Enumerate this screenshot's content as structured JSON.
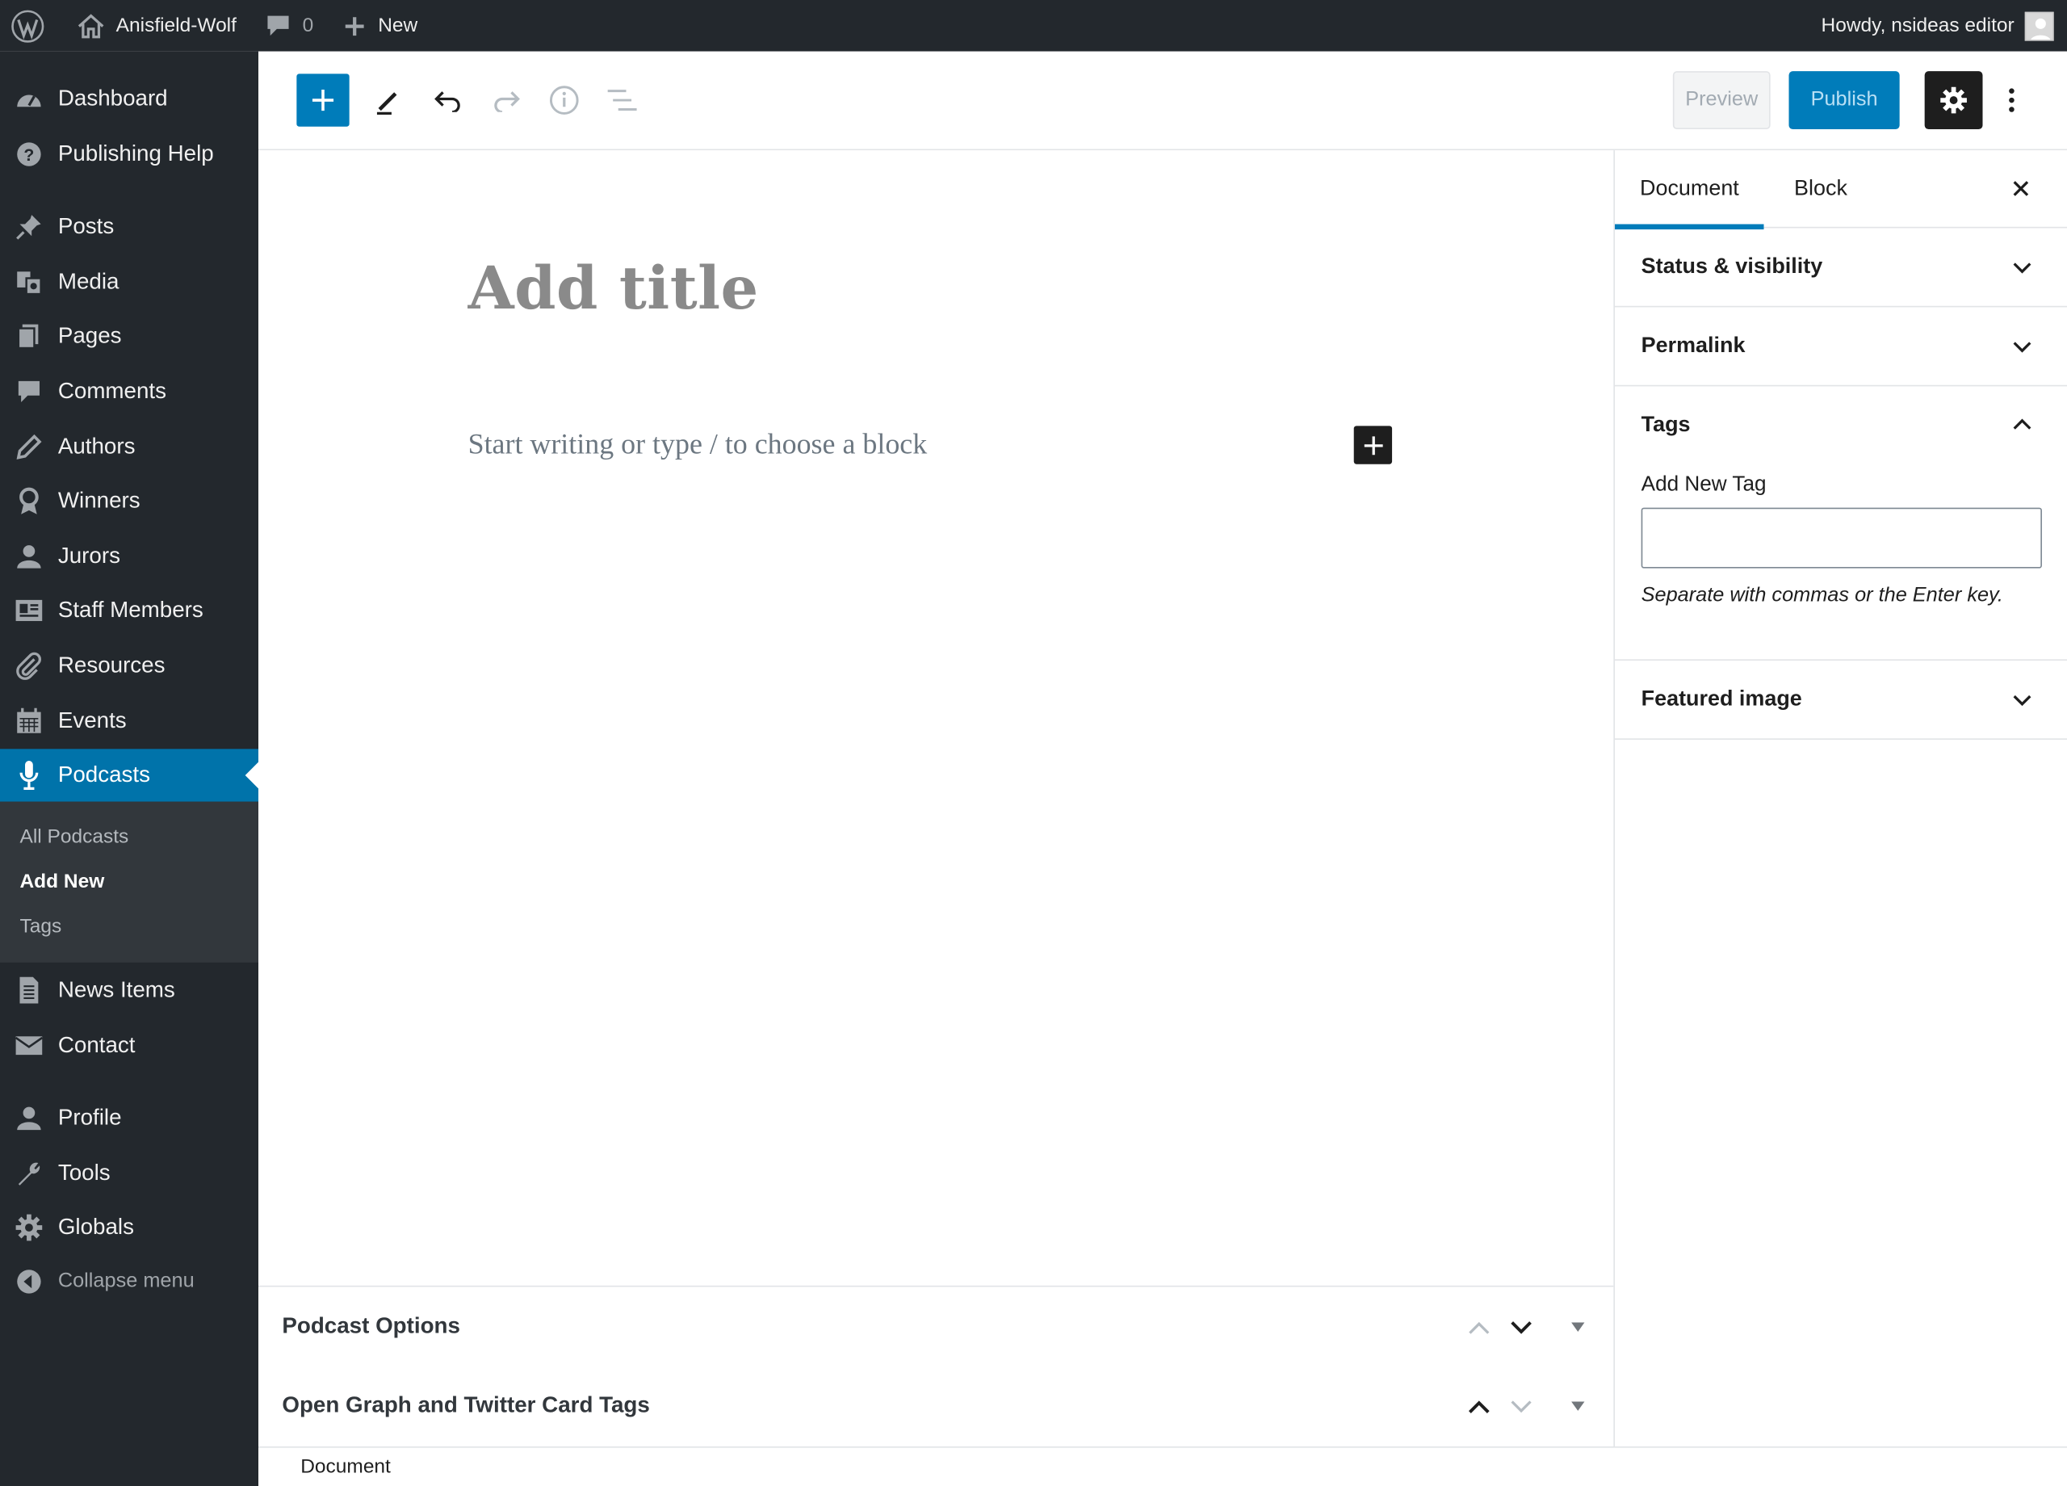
{
  "admin_bar": {
    "site_name": "Anisfield-Wolf",
    "comments_count": "0",
    "new_label": "New",
    "greeting": "Howdy, nsideas editor"
  },
  "sidebar": {
    "items": [
      {
        "label": "Dashboard",
        "icon": "dashboard-icon"
      },
      {
        "label": "Publishing Help",
        "icon": "help-icon"
      },
      {
        "label": "Posts",
        "icon": "pin-icon"
      },
      {
        "label": "Media",
        "icon": "media-icon"
      },
      {
        "label": "Pages",
        "icon": "pages-icon"
      },
      {
        "label": "Comments",
        "icon": "comment-icon"
      },
      {
        "label": "Authors",
        "icon": "pencil-icon"
      },
      {
        "label": "Winners",
        "icon": "award-icon"
      },
      {
        "label": "Jurors",
        "icon": "user-icon"
      },
      {
        "label": "Staff Members",
        "icon": "id-card-icon"
      },
      {
        "label": "Resources",
        "icon": "paperclip-icon"
      },
      {
        "label": "Events",
        "icon": "calendar-icon"
      },
      {
        "label": "Podcasts",
        "icon": "microphone-icon"
      },
      {
        "label": "News Items",
        "icon": "document-icon"
      },
      {
        "label": "Contact",
        "icon": "email-icon"
      },
      {
        "label": "Profile",
        "icon": "user-icon"
      },
      {
        "label": "Tools",
        "icon": "wrench-icon"
      },
      {
        "label": "Globals",
        "icon": "gear-icon"
      }
    ],
    "current": "Podcasts",
    "submenu": [
      "All Podcasts",
      "Add New",
      "Tags"
    ],
    "submenu_active": "Add New",
    "collapse_label": "Collapse menu"
  },
  "toolbar": {
    "preview_label": "Preview",
    "publish_label": "Publish"
  },
  "editor": {
    "title_placeholder": "Add title",
    "block_placeholder": "Start writing or type / to choose a block"
  },
  "metaboxes": [
    {
      "title": "Podcast Options"
    },
    {
      "title": "Open Graph and Twitter Card Tags"
    }
  ],
  "footer": {
    "breadcrumb": "Document"
  },
  "settings_sidebar": {
    "tabs": [
      "Document",
      "Block"
    ],
    "active_tab": "Document",
    "panels": [
      {
        "title": "Status & visibility",
        "expanded": false
      },
      {
        "title": "Permalink",
        "expanded": false
      },
      {
        "title": "Tags",
        "expanded": true
      },
      {
        "title": "Featured image",
        "expanded": false
      }
    ],
    "tags": {
      "label": "Add New Tag",
      "value": "",
      "help": "Separate with commas or the Enter key."
    }
  },
  "colors": {
    "admin_bg": "#23282d",
    "accent": "#0073aa",
    "primary_button": "#007cba",
    "submenu_bg": "#32373c"
  }
}
